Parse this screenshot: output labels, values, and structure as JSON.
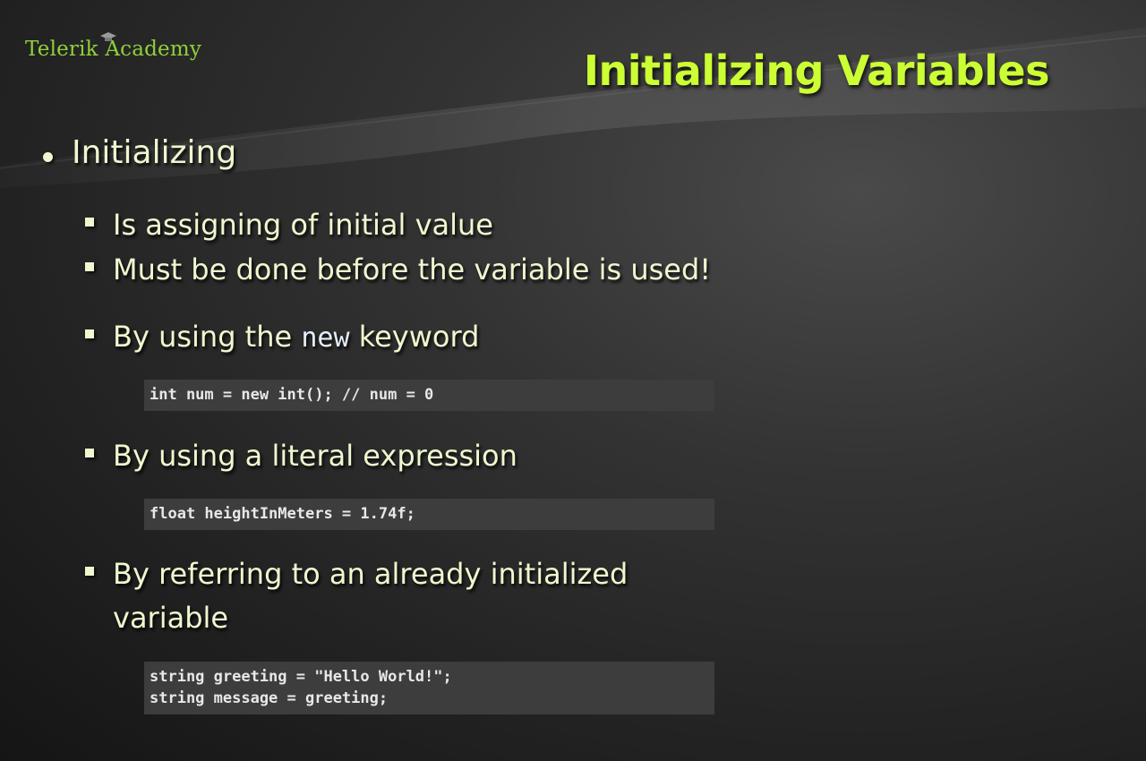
{
  "logo": {
    "text": "Telerik Academy"
  },
  "slide": {
    "title": "Initializing Variables"
  },
  "bullets": {
    "main": "Initializing",
    "items": [
      "Is assigning of initial value",
      "Must be done before the variable is used!"
    ],
    "new_keyword": {
      "before": "By using the ",
      "keyword": "new",
      "after": " keyword"
    },
    "literal": "By using a literal expression",
    "referring_line1": "By referring to an already initialized",
    "referring_line2": "variable"
  },
  "code": {
    "new_example": "int num = new int(); // num = 0",
    "literal_example": "float heightInMeters = 1.74f;",
    "ref_line1": "string greeting = \"Hello World!\";",
    "ref_line2": "string message = greeting;"
  }
}
